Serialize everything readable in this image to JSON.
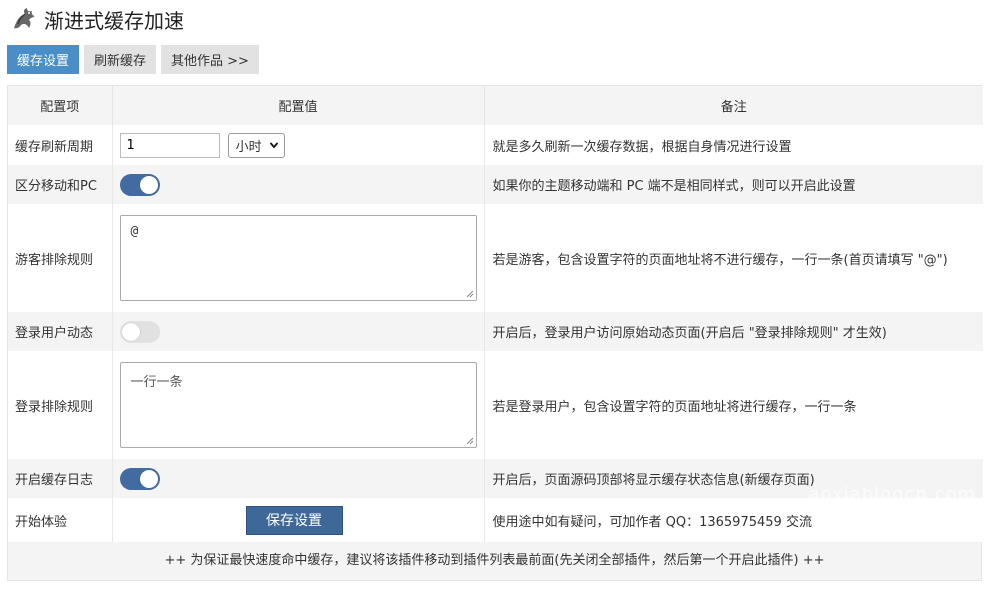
{
  "app": {
    "title": "渐进式缓存加速"
  },
  "tabs": [
    {
      "label": "缓存设置",
      "active": true
    },
    {
      "label": "刷新缓存",
      "active": false
    },
    {
      "label": "其他作品 >>",
      "active": false
    }
  ],
  "table": {
    "headers": [
      "配置项",
      "配置值",
      "备注"
    ],
    "rows": {
      "refresh": {
        "label": "缓存刷新周期",
        "value": "1",
        "unit": "小时",
        "note": "就是多久刷新一次缓存数据，根据自身情况进行设置"
      },
      "mobile": {
        "label": "区分移动和PC",
        "enabled": true,
        "note": "如果你的主题移动端和 PC 端不是相同样式，则可以开启此设置"
      },
      "guest_exclude": {
        "label": "游客排除规则",
        "value": "@",
        "note": "若是游客，包含设置字符的页面地址将不进行缓存，一行一条(首页请填写 \"@\")"
      },
      "logged_dynamic": {
        "label": "登录用户动态",
        "enabled": false,
        "note": "开启后，登录用户访问原始动态页面(开启后 \"登录排除规则\" 才生效)"
      },
      "logged_exclude": {
        "label": "登录排除规则",
        "placeholder": "一行一条",
        "note": "若是登录用户，包含设置字符的页面地址将进行缓存，一行一条"
      },
      "log": {
        "label": "开启缓存日志",
        "enabled": true,
        "note": "开启后，页面源码顶部将显示缓存状态信息(新缓存页面)"
      },
      "start": {
        "label": "开始体验",
        "button": "保存设置",
        "note": "使用途中如有疑问，可加作者 QQ：1365975459 交流"
      }
    },
    "footer": "++ 为保证最快速度命中缓存，建议将该插件移动到插件列表最前面(先关闭全部插件，然后第一个开启此插件) ++"
  },
  "watermark": "aoxiablogcn.com",
  "colors": {
    "tab_active": "#4a8ec7",
    "toggle_on": "#426ca1",
    "button": "#3e6898"
  }
}
